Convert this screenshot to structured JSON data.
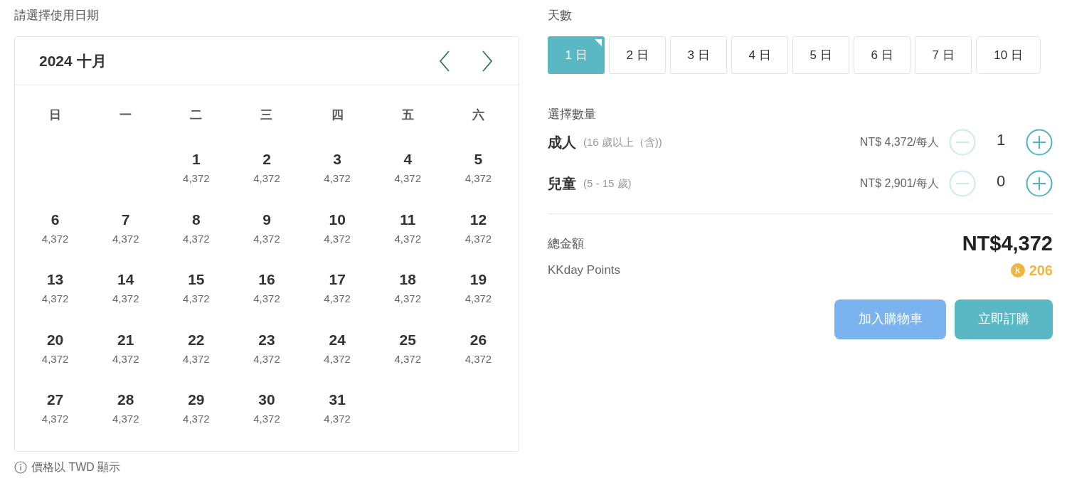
{
  "calendar": {
    "label": "請選擇使用日期",
    "month": "2024 十月",
    "weekdays": [
      "日",
      "一",
      "二",
      "三",
      "四",
      "五",
      "六"
    ],
    "weeks": [
      [
        {
          "kind": "empty"
        },
        {
          "kind": "empty"
        },
        {
          "kind": "day",
          "day": "1",
          "price": "4,372"
        },
        {
          "kind": "day",
          "day": "2",
          "price": "4,372"
        },
        {
          "kind": "day",
          "day": "3",
          "price": "4,372"
        },
        {
          "kind": "day",
          "day": "4",
          "price": "4,372"
        },
        {
          "kind": "day",
          "day": "5",
          "price": "4,372"
        }
      ],
      [
        {
          "kind": "day",
          "day": "6",
          "price": "4,372"
        },
        {
          "kind": "day",
          "day": "7",
          "price": "4,372"
        },
        {
          "kind": "day",
          "day": "8",
          "price": "4,372"
        },
        {
          "kind": "day",
          "day": "9",
          "price": "4,372"
        },
        {
          "kind": "day",
          "day": "10",
          "price": "4,372"
        },
        {
          "kind": "day",
          "day": "11",
          "price": "4,372"
        },
        {
          "kind": "day",
          "day": "12",
          "price": "4,372"
        }
      ],
      [
        {
          "kind": "day",
          "day": "13",
          "price": "4,372"
        },
        {
          "kind": "day",
          "day": "14",
          "price": "4,372"
        },
        {
          "kind": "day",
          "day": "15",
          "price": "4,372"
        },
        {
          "kind": "day",
          "day": "16",
          "price": "4,372"
        },
        {
          "kind": "day",
          "day": "17",
          "price": "4,372"
        },
        {
          "kind": "day",
          "day": "18",
          "price": "4,372"
        },
        {
          "kind": "day",
          "day": "19",
          "price": "4,372"
        }
      ],
      [
        {
          "kind": "day",
          "day": "20",
          "price": "4,372"
        },
        {
          "kind": "day",
          "day": "21",
          "price": "4,372"
        },
        {
          "kind": "day",
          "day": "22",
          "price": "4,372"
        },
        {
          "kind": "day",
          "day": "23",
          "price": "4,372"
        },
        {
          "kind": "day",
          "day": "24",
          "price": "4,372"
        },
        {
          "kind": "day",
          "day": "25",
          "price": "4,372"
        },
        {
          "kind": "day",
          "day": "26",
          "price": "4,372"
        }
      ],
      [
        {
          "kind": "day",
          "day": "27",
          "price": "4,372"
        },
        {
          "kind": "day",
          "day": "28",
          "price": "4,372"
        },
        {
          "kind": "day",
          "day": "29",
          "price": "4,372"
        },
        {
          "kind": "day",
          "day": "30",
          "price": "4,372"
        },
        {
          "kind": "day",
          "day": "31",
          "price": "4,372"
        },
        {
          "kind": "empty"
        },
        {
          "kind": "empty"
        }
      ]
    ],
    "note": "價格以 TWD 顯示"
  },
  "duration": {
    "label": "天數",
    "options": [
      {
        "label": "1 日",
        "selected": true
      },
      {
        "label": "2 日",
        "selected": false
      },
      {
        "label": "3 日",
        "selected": false
      },
      {
        "label": "4 日",
        "selected": false
      },
      {
        "label": "5 日",
        "selected": false
      },
      {
        "label": "6 日",
        "selected": false
      },
      {
        "label": "7 日",
        "selected": false
      },
      {
        "label": "10 日",
        "selected": false
      }
    ]
  },
  "quantity": {
    "label": "選擇數量",
    "rows": [
      {
        "name": "成人",
        "age": "(16 歲以上（含))",
        "price": "NT$ 4,372/每人",
        "count": "1",
        "minus_disabled": true
      },
      {
        "name": "兒童",
        "age": "(5 - 15 歲)",
        "price": "NT$ 2,901/每人",
        "count": "0",
        "minus_disabled": true
      }
    ]
  },
  "total": {
    "label": "總金額",
    "amount": "NT$4,372",
    "points_label": "KKday Points",
    "points": "206"
  },
  "buttons": {
    "cart": "加入購物車",
    "buy": "立即訂購"
  }
}
